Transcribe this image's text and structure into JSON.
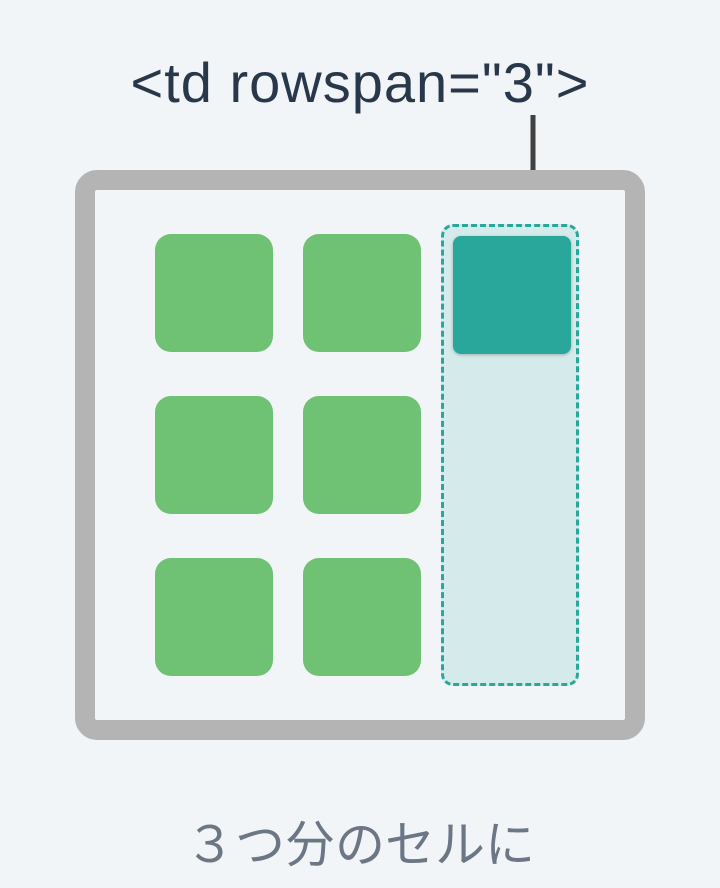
{
  "title": "<td rowspan=\"3\">",
  "caption": "３つ分のセルに",
  "diagram": {
    "grid": {
      "rows": 3,
      "cols": 3
    },
    "regular_cells": [
      {
        "row": 1,
        "col": 1
      },
      {
        "row": 1,
        "col": 2
      },
      {
        "row": 2,
        "col": 1
      },
      {
        "row": 2,
        "col": 2
      },
      {
        "row": 3,
        "col": 1
      },
      {
        "row": 3,
        "col": 2
      }
    ],
    "spanned_cell": {
      "row": 1,
      "col": 3,
      "rowspan": 3
    },
    "colors": {
      "page_bg": "#f2f5f7",
      "frame_border": "#b4b4b4",
      "cell_fill": "#6fc173",
      "span_border": "#2aa79b",
      "span_fill": "rgba(42,167,155,0.14)",
      "merged_cell_fill": "#2aa79b",
      "title_text": "#28384a",
      "caption_text": "#6b7785",
      "arrow": "#404040"
    }
  }
}
